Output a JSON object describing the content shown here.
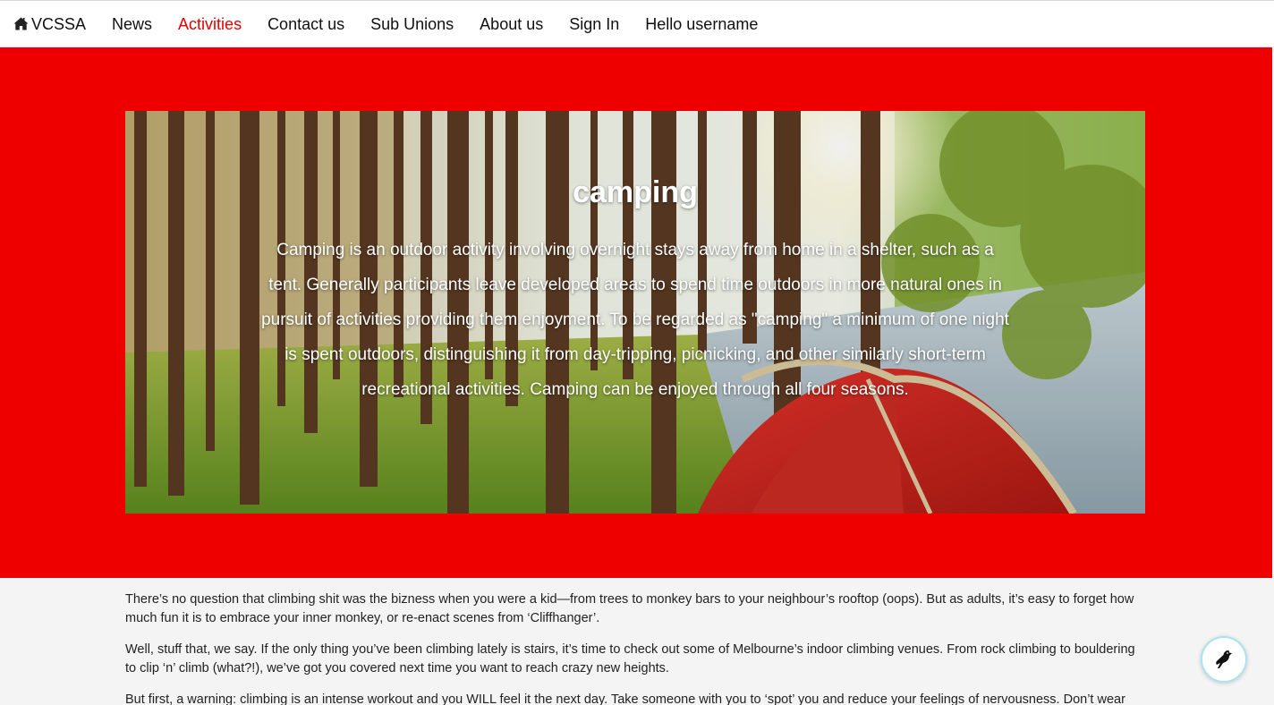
{
  "nav": {
    "brand": "VCSSA",
    "brand_icon": "home-icon",
    "items": [
      {
        "label": "News"
      },
      {
        "label": "Activities",
        "active": true
      },
      {
        "label": "Contact us"
      },
      {
        "label": "Sub Unions"
      },
      {
        "label": "About us"
      },
      {
        "label": "Sign In"
      },
      {
        "label": "Hello username"
      }
    ]
  },
  "hero": {
    "title": "camping",
    "text": "Camping is an outdoor activity involving overnight stays away from home in a shelter, such as a tent. Generally participants leave developed areas to spend time outdoors in more natural ones in pursuit of activities providing them enjoyment. To be regarded as \"camping\" a minimum of one night is spent outdoors, distinguishing it from day-tripping, picnicking, and other similarly short-term recreational activities. Camping can be enjoyed through all four seasons.",
    "image": "forest-camping-tent-photo"
  },
  "article": {
    "paragraphs": [
      "There’s no question that climbing shit was the bizness when you were a kid—from trees to monkey bars to your neighbour’s rooftop (oops). But as adults, it’s easy to forget how much fun it is to embrace your inner monkey, or re-enact scenes from ‘Cliffhanger’.",
      "Well, stuff that, we say. If the only thing you’ve been climbing lately is stairs, it’s time to check out some of Melbourne’s indoor climbing venues. From rock climbing to bouldering to clip ‘n’ climb (what?!), we’ve got you covered next time you want to reach crazy new heights.",
      "But first, a warning: climbing is an intense workout and you WILL feel it the next day. Take someone with you to ‘spot’ you and reduce your feelings of nervousness. Don’t wear"
    ]
  },
  "widget": {
    "icon": "bird-icon"
  },
  "colors": {
    "accent": "#ee0000",
    "active_link": "#e20000",
    "nav_bg": "#ffffff",
    "page_bg": "#f4f4f4"
  }
}
